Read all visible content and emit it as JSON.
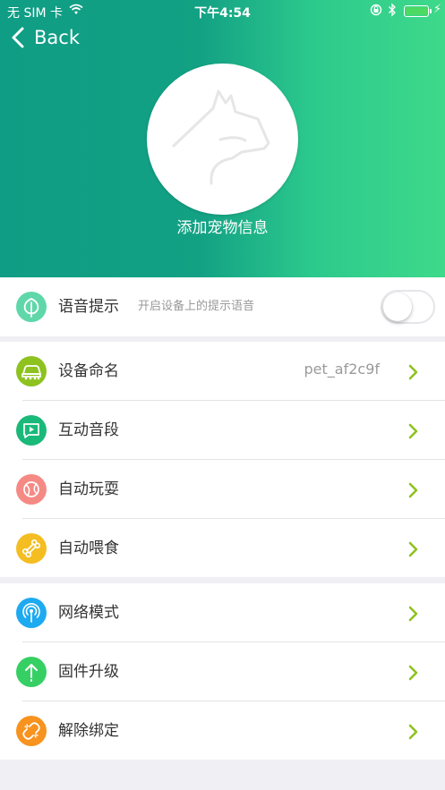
{
  "status_bar": {
    "carrier": "无 SIM 卡",
    "time": "下午4:54",
    "battery_color": "#4cd964"
  },
  "nav": {
    "back_label": "Back"
  },
  "header": {
    "pet_caption": "添加宠物信息",
    "gradient_start": "#0f9d85",
    "gradient_end": "#3ed98a"
  },
  "voice_prompt": {
    "label": "语音提示",
    "description": "开启设备上的提示语音",
    "enabled": false,
    "icon": "leaf-icon",
    "icon_color": "#5fd7a9"
  },
  "settings": [
    {
      "label": "设备命名",
      "value": "pet_af2c9f",
      "icon": "device-car-icon",
      "icon_color": "#8dc21f"
    },
    {
      "label": "互动音段",
      "value": "",
      "icon": "play-message-icon",
      "icon_color": "#1ab97a"
    },
    {
      "label": "自动玩耍",
      "value": "",
      "icon": "ball-icon",
      "icon_color": "#f58a85"
    },
    {
      "label": "自动喂食",
      "value": "",
      "icon": "bone-icon",
      "icon_color": "#f4bd22"
    }
  ],
  "system": [
    {
      "label": "网络模式",
      "icon": "antenna-icon",
      "icon_color": "#1eaaf1"
    },
    {
      "label": "固件升级",
      "icon": "upgrade-arrow-icon",
      "icon_color": "#36cf64"
    },
    {
      "label": "解除绑定",
      "icon": "unlink-icon",
      "icon_color": "#f7931e"
    }
  ],
  "arrow_color": "#8dc21f"
}
